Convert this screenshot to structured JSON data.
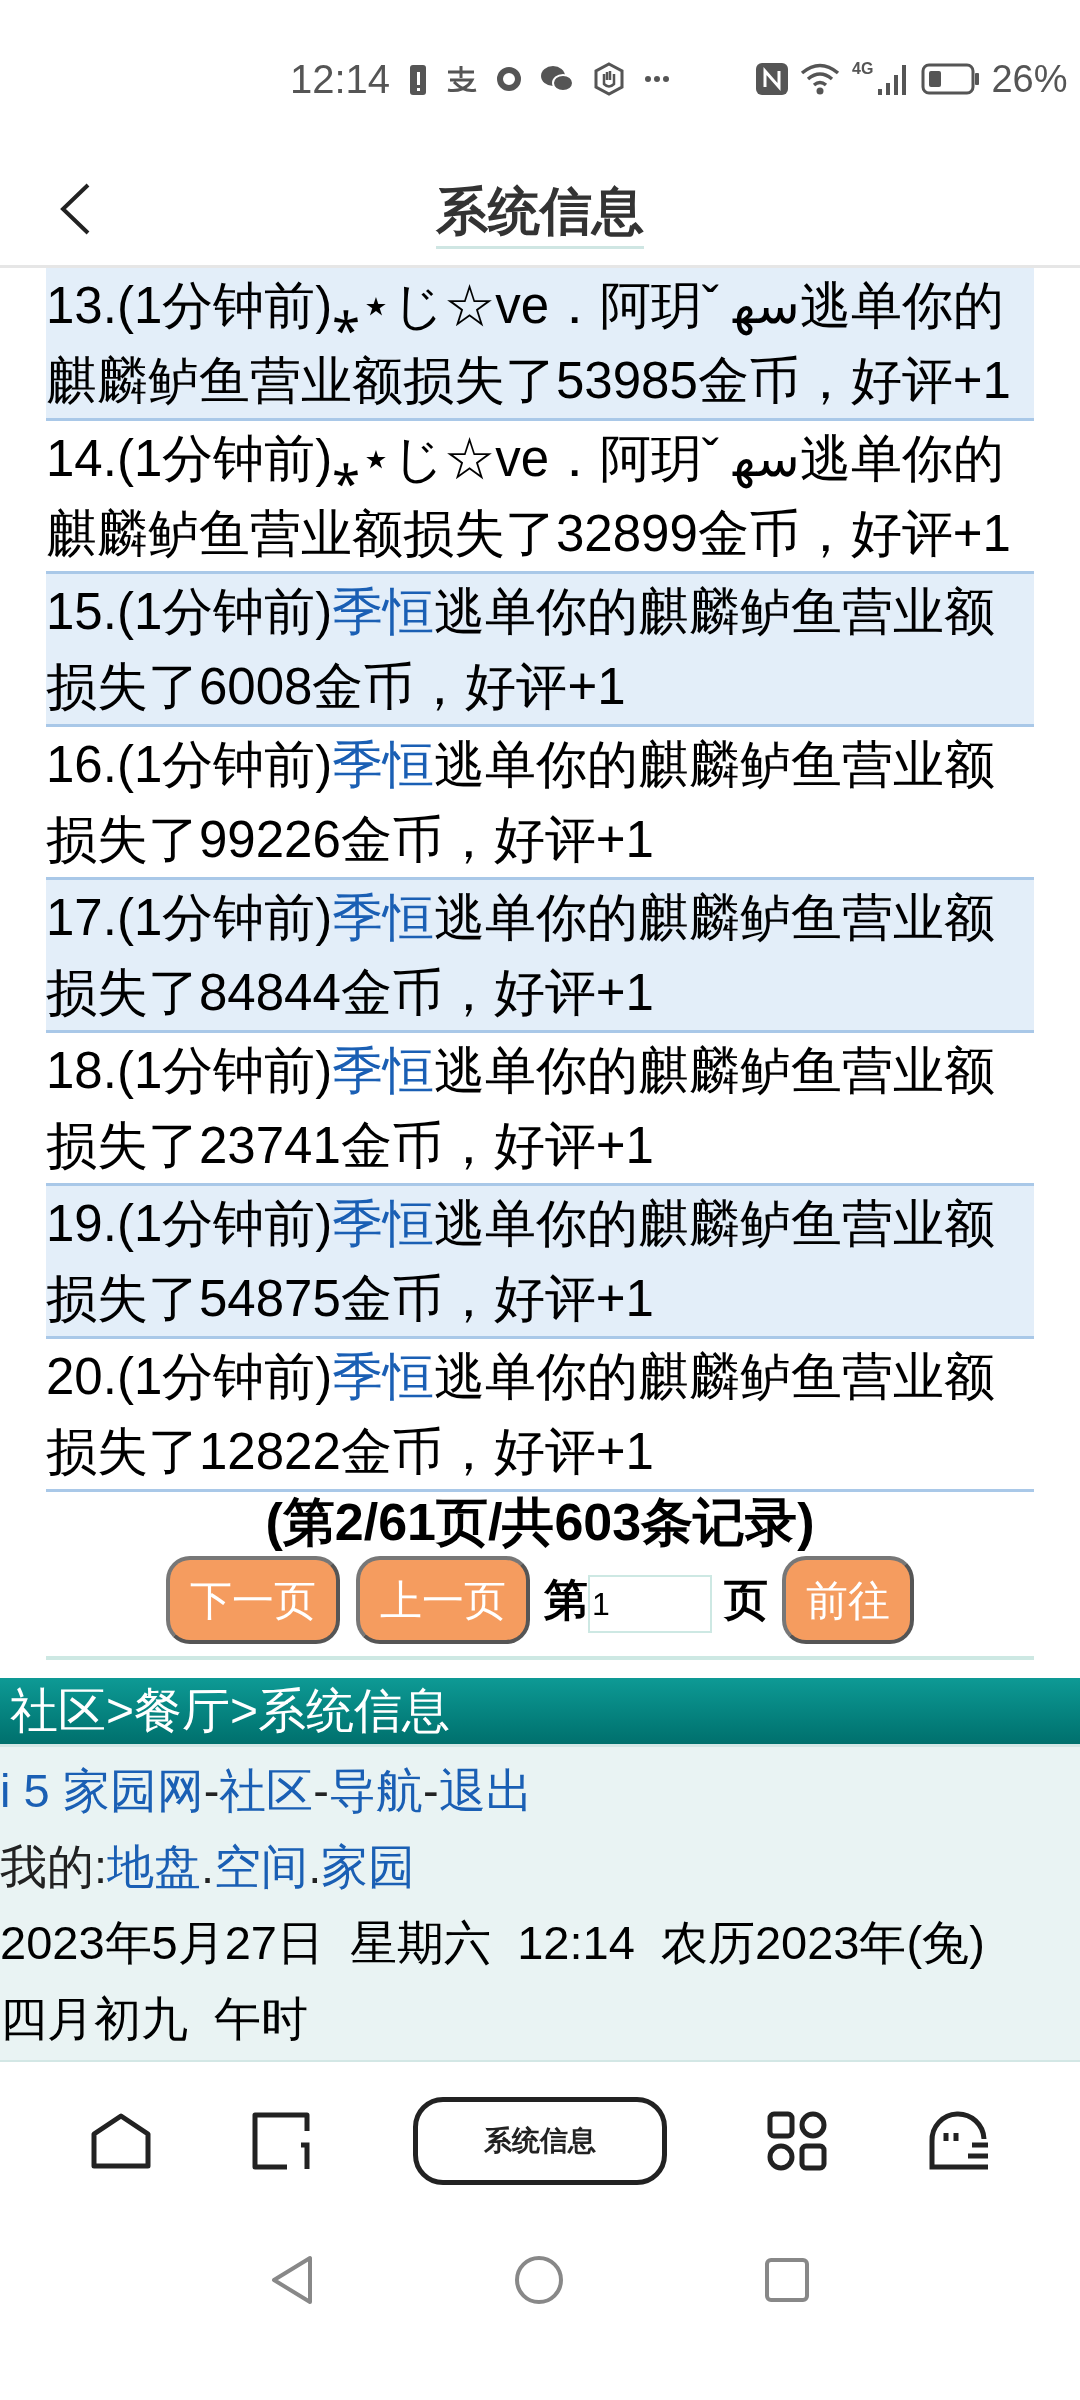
{
  "status_bar": {
    "time": "12:14",
    "network": "4G",
    "battery": "26%"
  },
  "header": {
    "title": "系统信息"
  },
  "records": [
    {
      "prefix": "13.(1分钟前)",
      "user": "⁎⋆じ☆ve．阿玥ˇ ﺳﻬ",
      "kind": "plain",
      "message": "逃单你的麒麟鲈鱼营业额损失了53985金币，好评+1"
    },
    {
      "prefix": "14.(1分钟前)",
      "user": "⁎⋆じ☆ve．阿玥ˇ ﺳﻬ",
      "kind": "plain",
      "message": "逃单你的麒麟鲈鱼营业额损失了32899金币，好评+1"
    },
    {
      "prefix": "15.(1分钟前)",
      "user": "季恒",
      "kind": "link",
      "message": "逃单你的麒麟鲈鱼营业额损失了6008金币，好评+1"
    },
    {
      "prefix": "16.(1分钟前)",
      "user": "季恒",
      "kind": "link",
      "message": "逃单你的麒麟鲈鱼营业额损失了99226金币，好评+1"
    },
    {
      "prefix": "17.(1分钟前)",
      "user": "季恒",
      "kind": "link",
      "message": "逃单你的麒麟鲈鱼营业额损失了84844金币，好评+1"
    },
    {
      "prefix": "18.(1分钟前)",
      "user": "季恒",
      "kind": "link",
      "message": "逃单你的麒麟鲈鱼营业额损失了23741金币，好评+1"
    },
    {
      "prefix": "19.(1分钟前)",
      "user": "季恒",
      "kind": "link",
      "message": "逃单你的麒麟鲈鱼营业额损失了54875金币，好评+1"
    },
    {
      "prefix": "20.(1分钟前)",
      "user": "季恒",
      "kind": "link",
      "message": "逃单你的麒麟鲈鱼营业额损失了12822金币，好评+1"
    }
  ],
  "summary": "(第2/61页/共603条记录)",
  "pager": {
    "next": "下一页",
    "previous": "上一页",
    "page_label": "第",
    "page_value": "1",
    "page_suffix": "页",
    "go": "前往"
  },
  "breadcrumb": "社区>餐厅>系统信息",
  "footer": {
    "nav_links": [
      "i 5 家园网",
      "社区",
      "导航",
      "退出"
    ],
    "nav_separator": "-",
    "my_label": "我的:",
    "my_links": [
      "地盘",
      "空间",
      "家园"
    ],
    "my_separator": ".",
    "date_line": "2023年5月27日  星期六  12:14  农历2023年(兔)  四月初九  午时"
  },
  "bottom_nav": {
    "center_label": "系统信息"
  }
}
